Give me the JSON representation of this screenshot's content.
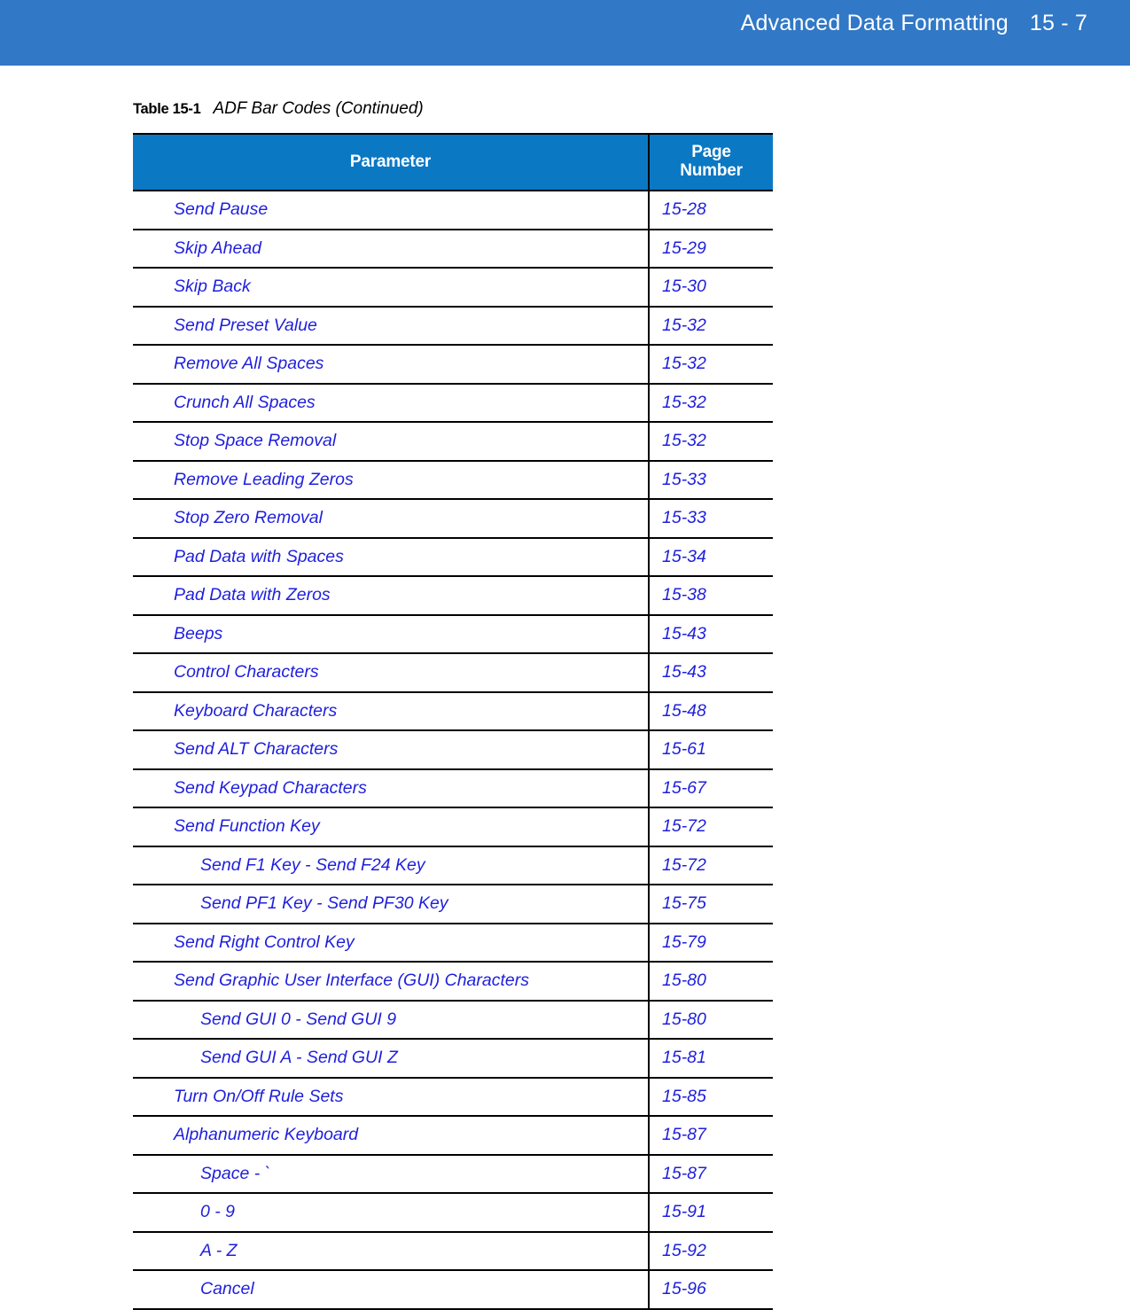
{
  "page_header": {
    "title": "Advanced Data Formatting",
    "page_number": "15 - 7",
    "band_color": "#3178c6",
    "text_color": "#ffffff"
  },
  "caption": {
    "label": "Table 15-1",
    "title": "ADF Bar Codes (Continued)"
  },
  "table": {
    "header_bg": "#0b78c4",
    "link_color": "#1f1fdd",
    "columns": {
      "parameter": "Parameter",
      "page_number_line1": "Page",
      "page_number_line2": "Number"
    },
    "rows": [
      {
        "parameter": "Send Pause",
        "page": "15-28",
        "indent": false
      },
      {
        "parameter": "Skip Ahead",
        "page": "15-29",
        "indent": false
      },
      {
        "parameter": "Skip Back",
        "page": "15-30",
        "indent": false
      },
      {
        "parameter": "Send Preset Value",
        "page": "15-32",
        "indent": false
      },
      {
        "parameter": "Remove All Spaces",
        "page": "15-32",
        "indent": false
      },
      {
        "parameter": "Crunch All Spaces",
        "page": "15-32",
        "indent": false
      },
      {
        "parameter": "Stop Space Removal",
        "page": "15-32",
        "indent": false
      },
      {
        "parameter": "Remove Leading Zeros",
        "page": "15-33",
        "indent": false
      },
      {
        "parameter": "Stop Zero Removal",
        "page": "15-33",
        "indent": false
      },
      {
        "parameter": "Pad Data with Spaces",
        "page": "15-34",
        "indent": false
      },
      {
        "parameter": "Pad Data with Zeros",
        "page": "15-38",
        "indent": false
      },
      {
        "parameter": "Beeps",
        "page": "15-43",
        "indent": false
      },
      {
        "parameter": "Control Characters",
        "page": "15-43",
        "indent": false
      },
      {
        "parameter": "Keyboard Characters",
        "page": "15-48",
        "indent": false
      },
      {
        "parameter": "Send ALT Characters",
        "page": "15-61",
        "indent": false
      },
      {
        "parameter": "Send Keypad Characters",
        "page": "15-67",
        "indent": false
      },
      {
        "parameter": "Send Function Key",
        "page": "15-72",
        "indent": false
      },
      {
        "parameter": "Send F1 Key - Send F24 Key",
        "page": "15-72",
        "indent": true
      },
      {
        "parameter": "Send PF1 Key - Send PF30 Key",
        "page": "15-75",
        "indent": true
      },
      {
        "parameter": "Send Right Control Key",
        "page": "15-79",
        "indent": false
      },
      {
        "parameter": "Send Graphic User Interface (GUI) Characters",
        "page": "15-80",
        "indent": false
      },
      {
        "parameter": "Send GUI 0 - Send GUI 9",
        "page": "15-80",
        "indent": true
      },
      {
        "parameter": "Send GUI A - Send GUI Z",
        "page": "15-81",
        "indent": true
      },
      {
        "parameter": "Turn On/Off Rule Sets",
        "page": "15-85",
        "indent": false
      },
      {
        "parameter": "Alphanumeric Keyboard",
        "page": "15-87",
        "indent": false
      },
      {
        "parameter": "Space - `",
        "page": "15-87",
        "indent": true
      },
      {
        "parameter": "0 - 9",
        "page": "15-91",
        "indent": true
      },
      {
        "parameter": "A - Z",
        "page": "15-92",
        "indent": true
      },
      {
        "parameter": "Cancel",
        "page": "15-96",
        "indent": true
      }
    ]
  }
}
